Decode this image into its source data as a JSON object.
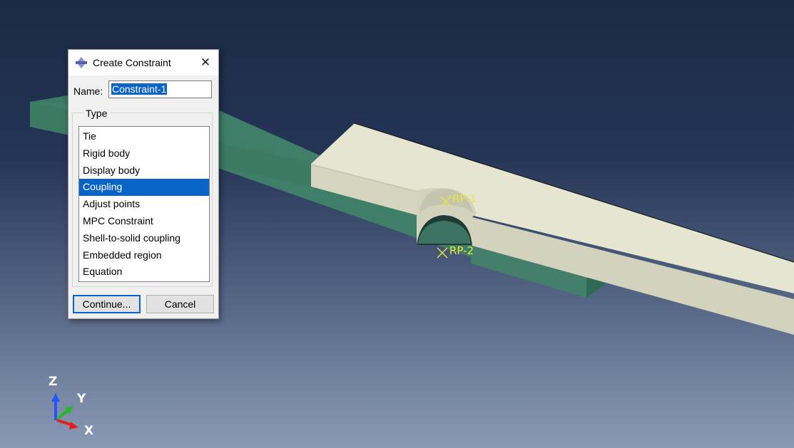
{
  "dialog": {
    "title": "Create Constraint",
    "name_label": "Name:",
    "name_value": "Constraint-1",
    "type_group_label": "Type",
    "type_options": [
      "Tie",
      "Rigid body",
      "Display body",
      "Coupling",
      "Adjust points",
      "MPC Constraint",
      "Shell-to-solid coupling",
      "Embedded region",
      "Equation"
    ],
    "selected_type": "Coupling",
    "continue_label": "Continue...",
    "cancel_label": "Cancel"
  },
  "viewport": {
    "reference_points": [
      "RP-1",
      "RP-2"
    ],
    "axes": {
      "z": "Z",
      "y": "Y",
      "x": "X"
    }
  },
  "colors": {
    "background_top": "#1b2a45",
    "background_bottom": "#8a9ab5",
    "lower_plate": "#3f7f69",
    "upper_plate": "#e4e3cf",
    "reference_point": "#e8e83a",
    "selection": "#0a64c8"
  },
  "icons": [
    "constraint-icon",
    "close-icon"
  ]
}
